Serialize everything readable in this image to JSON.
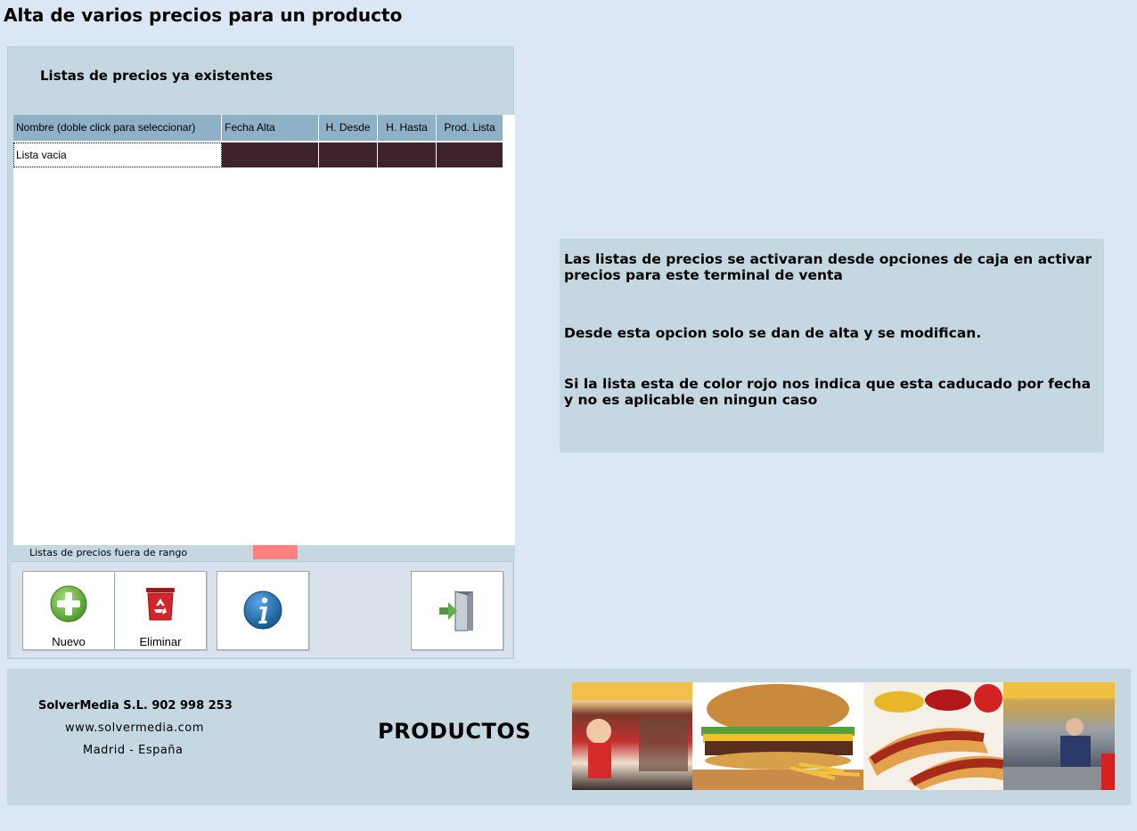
{
  "window": {
    "title": "Alta de varios precios para un producto"
  },
  "prices_panel": {
    "subtitle": "Listas de precios ya existentes",
    "columns": [
      "Nombre (doble click para seleccionar)",
      "Fecha Alta",
      "H. Desde",
      "H. Hasta",
      "Prod. Lista"
    ],
    "rows": [
      {
        "name": "Lista vacia",
        "fecha_alta": "",
        "h_desde": "",
        "h_hasta": "",
        "prod_lista": ""
      }
    ],
    "legend_label": "Listas de precios fuera de rango",
    "legend_color": "#ff8080"
  },
  "buttons": {
    "new_label": "Nuevo",
    "delete_label": "Eliminar",
    "info_icon": "info-icon",
    "exit_icon": "exit-door-icon"
  },
  "info": {
    "line1": "Las listas de precios se activaran desde opciones de caja en activar precios para este terminal de venta",
    "line2": "Desde esta opcion solo se dan de alta y se modifican.",
    "line3": "Si la lista esta de color rojo nos indica que esta caducado por fecha y no es aplicable en ningun caso"
  },
  "footer": {
    "company": "SolverMedia S.L. 902 998 253",
    "website": "www.solvermedia.com",
    "location": "Madrid - España",
    "section": "PRODUCTOS"
  },
  "colors": {
    "background": "#dbe7f5",
    "panel": "#c5d8e2",
    "header": "#8eb1c7",
    "row_dark": "#3e222c",
    "out_of_range": "#ff8080"
  }
}
